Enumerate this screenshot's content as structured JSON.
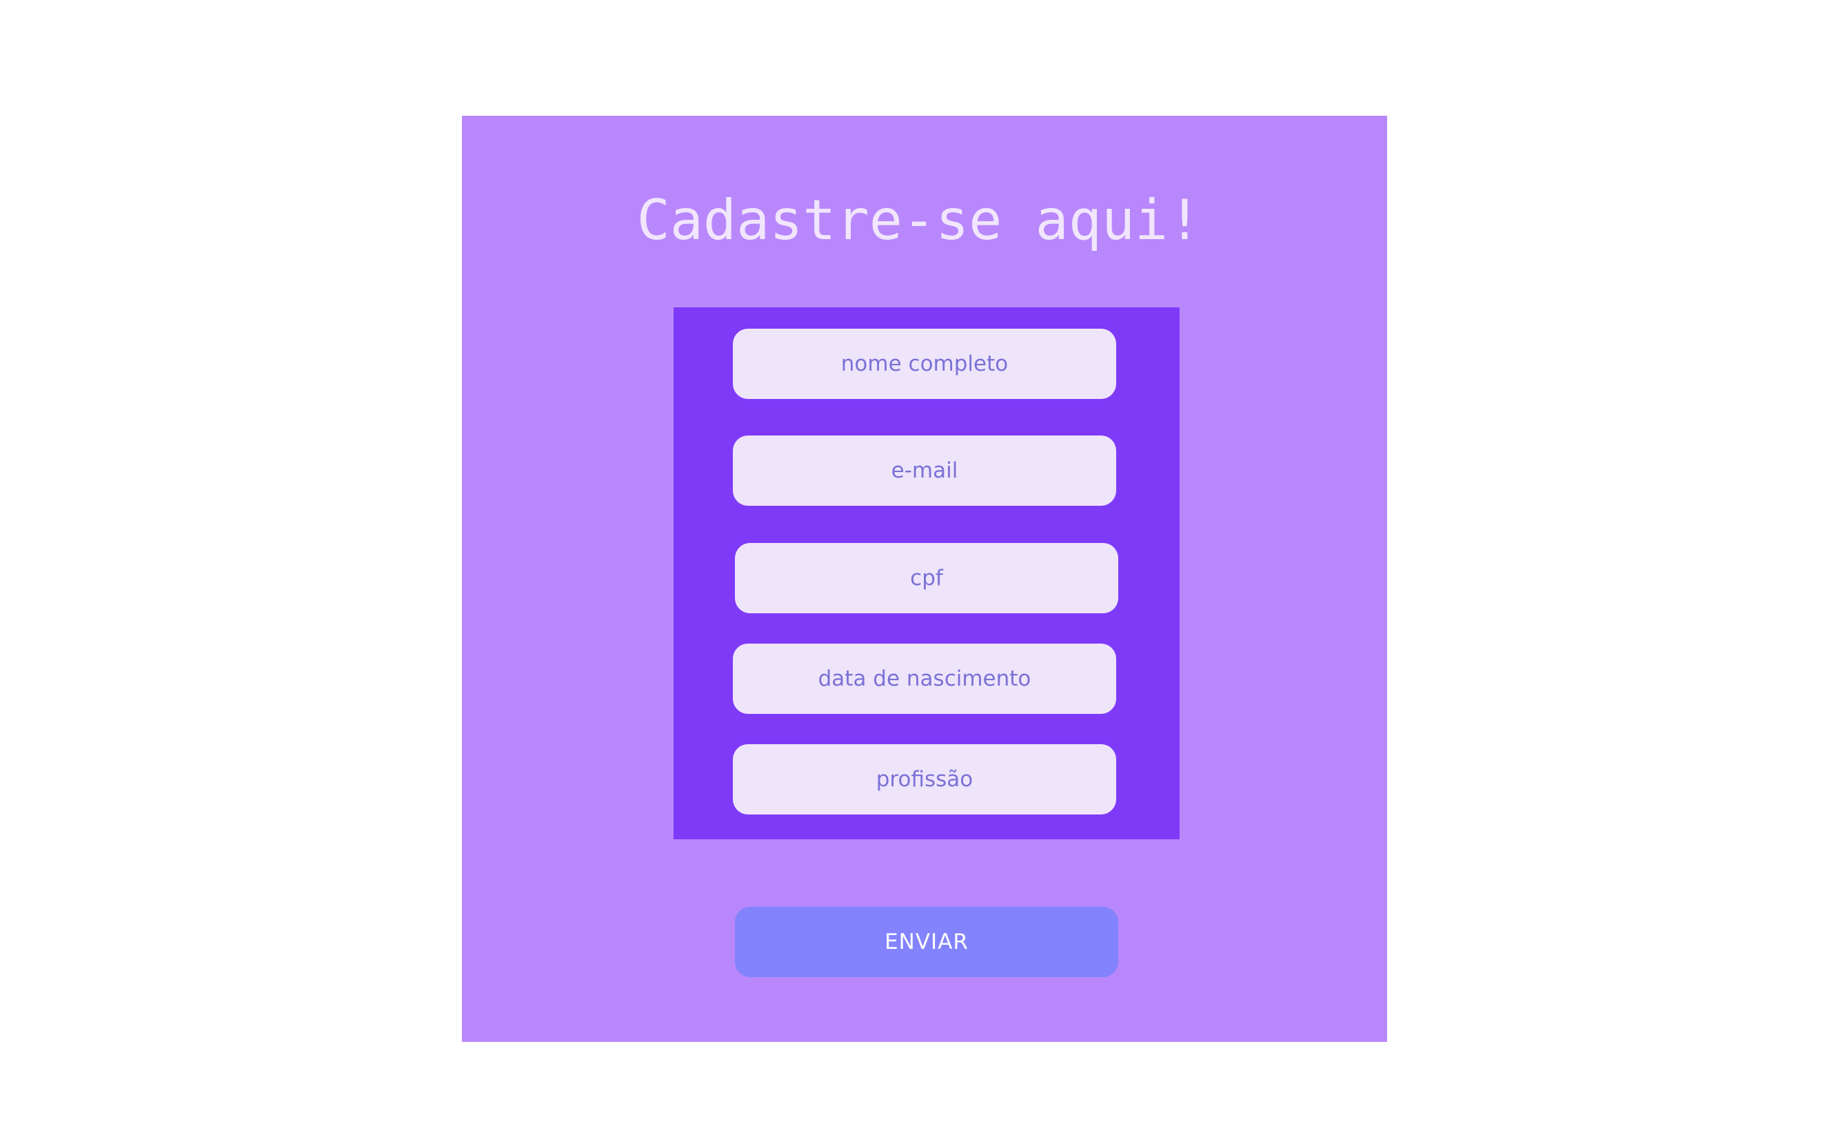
{
  "page": {
    "title": "Cadastre-se aqui!"
  },
  "form": {
    "fields": [
      {
        "name": "nome",
        "placeholder": "nome completo",
        "value": ""
      },
      {
        "name": "email",
        "placeholder": "e-mail",
        "value": ""
      },
      {
        "name": "cpf",
        "placeholder": "cpf",
        "value": ""
      },
      {
        "name": "nascimento",
        "placeholder": "data de nascimento",
        "value": ""
      },
      {
        "name": "profissao",
        "placeholder": "profissão",
        "value": ""
      }
    ],
    "submit_label": "ENVIAR"
  },
  "colors": {
    "page_background": "#ffffff",
    "card_background": "#b987fc",
    "form_panel_background": "#7f3af8",
    "field_background": "#efe5fb",
    "field_text": "#7a72d6",
    "title_text": "#f1e6fd",
    "button_background": "#8283fd",
    "button_text": "#ffffff"
  }
}
